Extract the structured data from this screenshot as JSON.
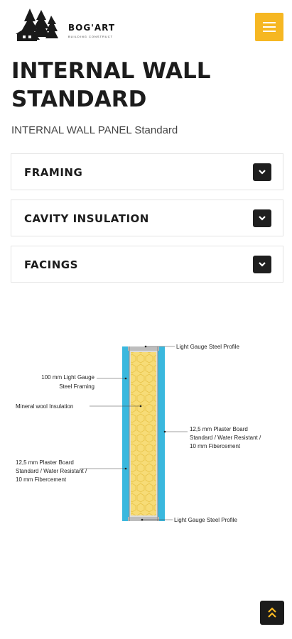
{
  "header": {
    "brand": "BOG'ART",
    "tagline": "BUILDING CONSTRUCT",
    "menu_icon": "hamburger-icon",
    "accent_color": "#f6b722"
  },
  "page": {
    "title": "INTERNAL WALL STANDARD",
    "subtitle": "INTERNAL WALL PANEL Standard"
  },
  "accordion": [
    {
      "label": "FRAMING",
      "icon": "chevron-down-icon"
    },
    {
      "label": "CAVITY INSULATION",
      "icon": "chevron-down-icon"
    },
    {
      "label": "FACINGS",
      "icon": "chevron-down-icon"
    }
  ],
  "diagram": {
    "top_profile": "Light Gauge Steel Profile",
    "framing_1": "100 mm Light Gauge",
    "framing_2": "Steel Framing",
    "insulation": "Mineral wool Insulation",
    "board_right_1": "12,5 mm Plaster Board",
    "board_right_2": "Standard / Water Resistant /",
    "board_right_3": "10 mm Fibercement",
    "board_left_1": "12,5 mm Plaster Board",
    "board_left_2": "Standard / Water Resistant /",
    "board_left_3": "10 mm Fibercement",
    "bottom_profile": "Light Gauge Steel Profile"
  },
  "scroll_top": {
    "icon": "double-chevron-up-icon"
  }
}
